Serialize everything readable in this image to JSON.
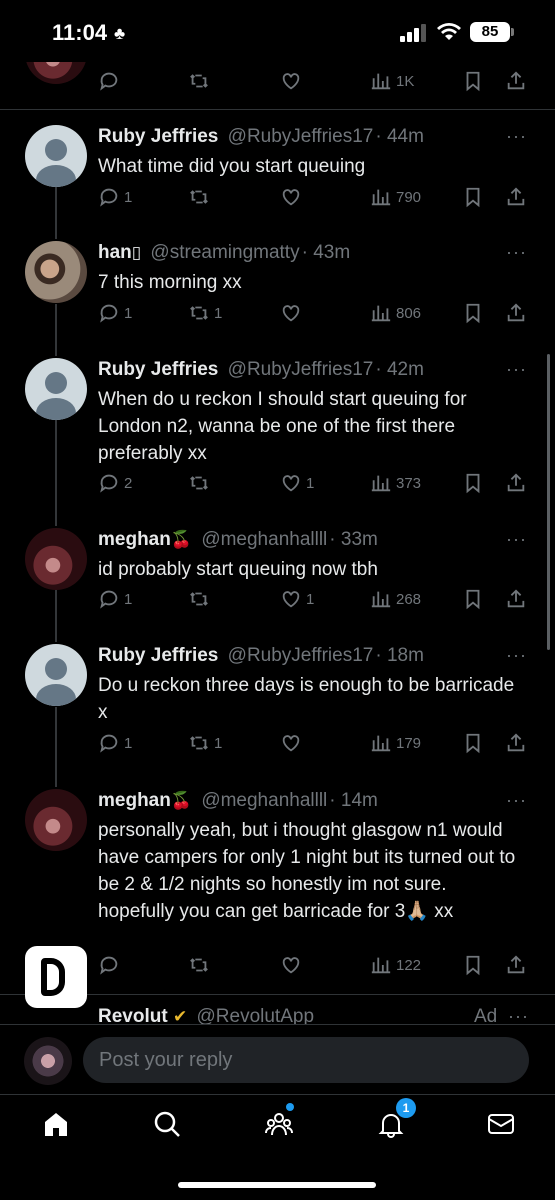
{
  "status_bar": {
    "time": "11:04",
    "battery": "85"
  },
  "top_actions": {
    "views": "1K"
  },
  "tweets": [
    {
      "name": "Ruby Jeffries",
      "handle": "@RubyJeffries17",
      "time": "· 44m",
      "text": "What time did you start queuing",
      "replies": "1",
      "retweets": "",
      "likes": "",
      "views": "790",
      "avatar": "default-avatar"
    },
    {
      "name": "han",
      "emoji": "▯",
      "handle": "@streamingmatty",
      "time": "· 43m",
      "text": "7 this morning xx",
      "replies": "1",
      "retweets": "1",
      "likes": "",
      "views": "806",
      "avatar": "profile-photo"
    },
    {
      "name": "Ruby Jeffries",
      "handle": "@RubyJeffries17",
      "time": "· 42m",
      "text": "When do u reckon I should start queuing for London n2, wanna be one of the first there preferably xx",
      "replies": "2",
      "retweets": "",
      "likes": "1",
      "views": "373",
      "avatar": "default-avatar"
    },
    {
      "name": "meghan",
      "emoji": "🍒",
      "handle": "@meghanhallll",
      "time": "· 33m",
      "text": "id probably start queuing now tbh",
      "replies": "1",
      "retweets": "",
      "likes": "1",
      "views": "268",
      "avatar": "profile-photo"
    },
    {
      "name": "Ruby Jeffries",
      "handle": "@RubyJeffries17",
      "time": "· 18m",
      "text": "Do u reckon three days is enough to be barricade x",
      "replies": "1",
      "retweets": "1",
      "likes": "",
      "views": "179",
      "avatar": "default-avatar"
    },
    {
      "name": "meghan",
      "emoji": "🍒",
      "handle": "@meghanhallll",
      "time": "· 14m",
      "text": "personally yeah, but i thought glasgow n1 would have campers for only 1 night but its turned out to be 2 & 1/2 nights so honestly im not sure. hopefully you can get barricade for 3🙏🏼 xx",
      "replies": "",
      "retweets": "",
      "likes": "",
      "views": "122",
      "avatar": "profile-photo"
    }
  ],
  "ad": {
    "name": "Revolut",
    "verified": "✔",
    "handle": "@RevolutApp",
    "label": "Ad",
    "more": "···"
  },
  "reply_bar": {
    "placeholder": "Post your reply"
  },
  "nav": {
    "notifications_badge": "1"
  },
  "more_glyph": "···",
  "colors": {
    "background": "#000000",
    "text": "#e7e9ea",
    "muted": "#71767b",
    "accent": "#1d9bf0",
    "divider": "#2f3336"
  }
}
